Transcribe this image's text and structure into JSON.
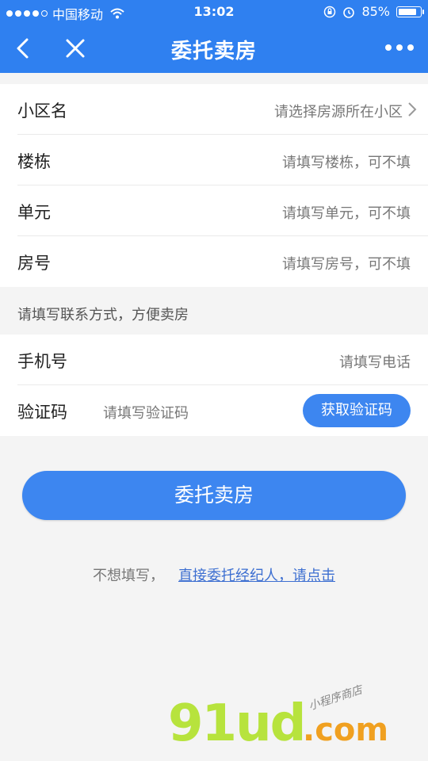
{
  "status_bar": {
    "carrier": "中国移动",
    "time": "13:02",
    "battery": "85%",
    "battery_level": 0.85,
    "icons": [
      "signal-dots",
      "wifi-icon",
      "lock-rotation-icon",
      "alarm-icon",
      "battery-icon"
    ]
  },
  "nav": {
    "title": "委托卖房",
    "back_icon": "chevron-left-icon",
    "close_icon": "close-icon",
    "more_icon": "more-dots-icon"
  },
  "house_form": [
    {
      "label": "小区名",
      "placeholder": "请选择房源所在小区",
      "has_chevron": true
    },
    {
      "label": "楼栋",
      "placeholder": "请填写楼栋，可不填"
    },
    {
      "label": "单元",
      "placeholder": "请填写单元，可不填"
    },
    {
      "label": "房号",
      "placeholder": "请填写房号，可不填"
    }
  ],
  "contact_hint": "请填写联系方式，方便卖房",
  "contact_form": {
    "phone_label": "手机号",
    "phone_placeholder": "请填写电话",
    "code_label": "验证码",
    "code_placeholder": "请填写验证码",
    "code_button": "获取验证码"
  },
  "submit_label": "委托卖房",
  "direct": {
    "prefix": "不想填写，",
    "link": "直接委托经纪人，请点击"
  },
  "watermark": {
    "main": "91ud",
    "suffix": ".com",
    "caption": "小程序商店"
  },
  "colors": {
    "brand_blue": "#2f80f0",
    "button_blue": "#3d86f0",
    "background": "#f4f4f4"
  }
}
